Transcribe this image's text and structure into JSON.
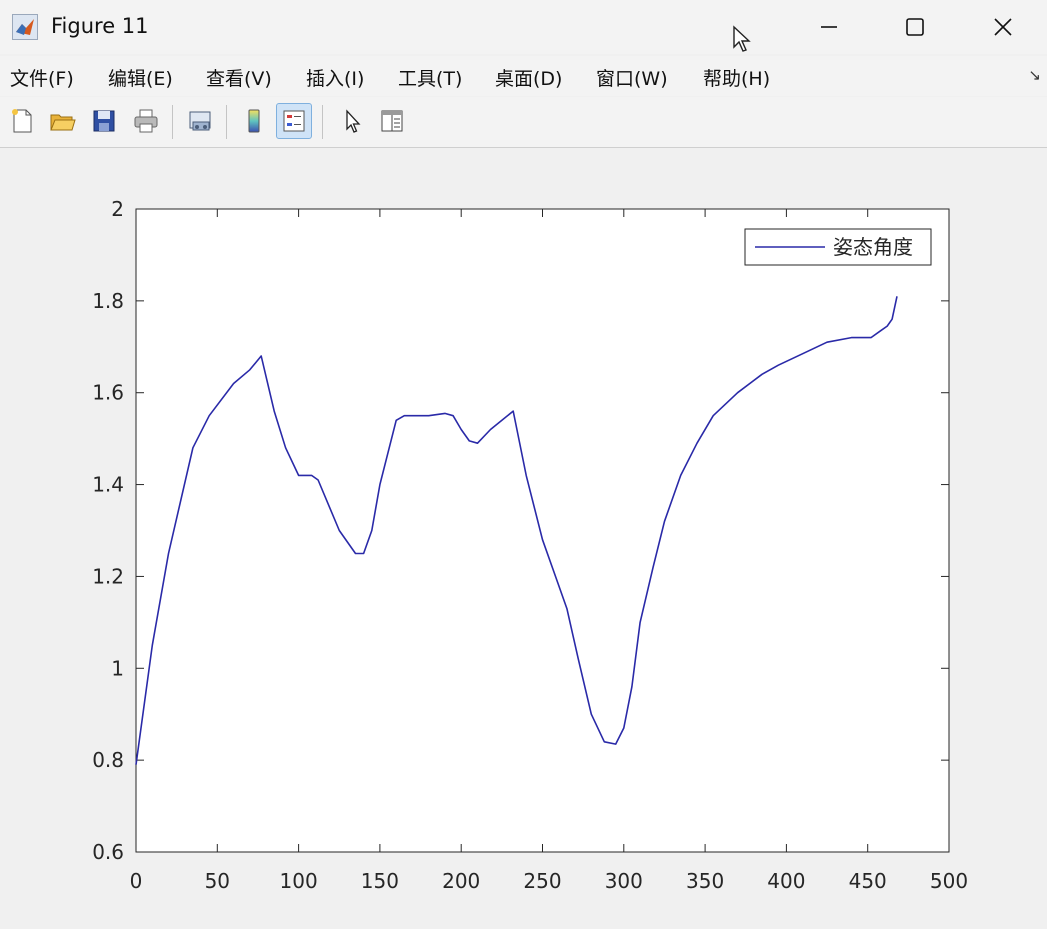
{
  "window": {
    "title": "Figure 11",
    "icon": "matlab-figure-icon",
    "controls": [
      "minimize-icon",
      "maximize-icon",
      "close-icon"
    ]
  },
  "menu": {
    "items": [
      "文件(F)",
      "编辑(E)",
      "查看(V)",
      "插入(I)",
      "工具(T)",
      "桌面(D)",
      "窗口(W)",
      "帮助(H)"
    ],
    "overflow_icon": "dock-arrow-icon"
  },
  "toolbar": {
    "tools": [
      "new-figure-icon",
      "open-file-icon",
      "save-icon",
      "print-icon",
      "link-plot-icon",
      "colorbar-icon",
      "legend-icon",
      "edit-plot-cursor-icon",
      "property-inspector-icon"
    ],
    "active_tool": "legend-icon"
  },
  "colors": {
    "line": "#2a2aa8",
    "axes_bg": "#ffffff",
    "figure_bg": "#f0f0f0"
  },
  "chart_data": {
    "type": "line",
    "title": "",
    "xlabel": "",
    "ylabel": "",
    "xlim": [
      0,
      500
    ],
    "ylim": [
      0.6,
      2
    ],
    "xticks": [
      0,
      50,
      100,
      150,
      200,
      250,
      300,
      350,
      400,
      450,
      500
    ],
    "yticks": [
      0.6,
      0.8,
      1,
      1.2,
      1.4,
      1.6,
      1.8,
      2
    ],
    "ytick_labels": [
      "0.6",
      "0.8",
      "1",
      "1.2",
      "1.4",
      "1.6",
      "1.8",
      "2"
    ],
    "grid": false,
    "legend": {
      "position": "top-right"
    },
    "series": [
      {
        "name": "姿态角度",
        "color": "#2a2aa8",
        "x": [
          0,
          10,
          20,
          35,
          45,
          60,
          70,
          77,
          85,
          92,
          100,
          108,
          112,
          125,
          135,
          140,
          145,
          150,
          160,
          165,
          170,
          180,
          190,
          195,
          200,
          205,
          210,
          218,
          225,
          232,
          240,
          250,
          258,
          265,
          272,
          280,
          288,
          295,
          300,
          305,
          310,
          318,
          325,
          335,
          345,
          355,
          370,
          385,
          395,
          410,
          425,
          440,
          452,
          458,
          462,
          465,
          468
        ],
        "y": [
          0.79,
          1.05,
          1.25,
          1.48,
          1.55,
          1.62,
          1.65,
          1.68,
          1.56,
          1.48,
          1.42,
          1.42,
          1.41,
          1.3,
          1.25,
          1.25,
          1.3,
          1.4,
          1.54,
          1.55,
          1.55,
          1.55,
          1.555,
          1.55,
          1.52,
          1.495,
          1.49,
          1.52,
          1.54,
          1.56,
          1.42,
          1.28,
          1.2,
          1.13,
          1.02,
          0.9,
          0.84,
          0.835,
          0.87,
          0.96,
          1.1,
          1.22,
          1.32,
          1.42,
          1.49,
          1.55,
          1.6,
          1.64,
          1.66,
          1.685,
          1.71,
          1.72,
          1.72,
          1.735,
          1.745,
          1.76,
          1.81
        ]
      }
    ]
  }
}
